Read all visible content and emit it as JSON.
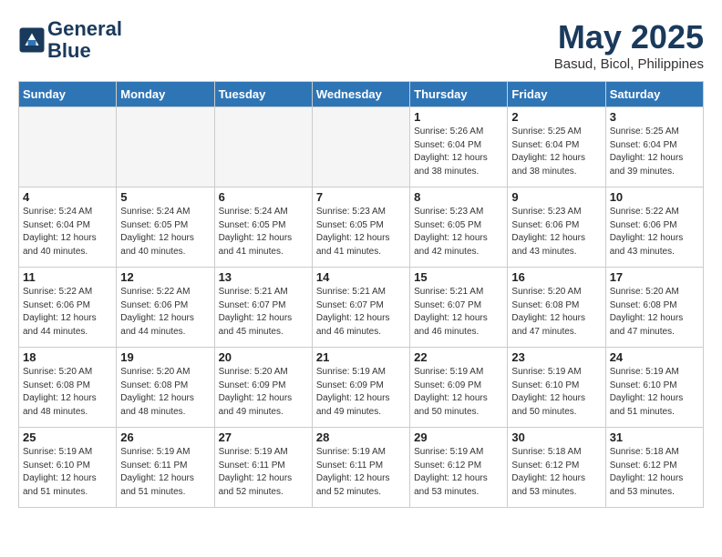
{
  "header": {
    "logo_line1": "General",
    "logo_line2": "Blue",
    "month": "May 2025",
    "location": "Basud, Bicol, Philippines"
  },
  "weekdays": [
    "Sunday",
    "Monday",
    "Tuesday",
    "Wednesday",
    "Thursday",
    "Friday",
    "Saturday"
  ],
  "weeks": [
    [
      {
        "day": "",
        "detail": ""
      },
      {
        "day": "",
        "detail": ""
      },
      {
        "day": "",
        "detail": ""
      },
      {
        "day": "",
        "detail": ""
      },
      {
        "day": "1",
        "detail": "Sunrise: 5:26 AM\nSunset: 6:04 PM\nDaylight: 12 hours\nand 38 minutes."
      },
      {
        "day": "2",
        "detail": "Sunrise: 5:25 AM\nSunset: 6:04 PM\nDaylight: 12 hours\nand 38 minutes."
      },
      {
        "day": "3",
        "detail": "Sunrise: 5:25 AM\nSunset: 6:04 PM\nDaylight: 12 hours\nand 39 minutes."
      }
    ],
    [
      {
        "day": "4",
        "detail": "Sunrise: 5:24 AM\nSunset: 6:04 PM\nDaylight: 12 hours\nand 40 minutes."
      },
      {
        "day": "5",
        "detail": "Sunrise: 5:24 AM\nSunset: 6:05 PM\nDaylight: 12 hours\nand 40 minutes."
      },
      {
        "day": "6",
        "detail": "Sunrise: 5:24 AM\nSunset: 6:05 PM\nDaylight: 12 hours\nand 41 minutes."
      },
      {
        "day": "7",
        "detail": "Sunrise: 5:23 AM\nSunset: 6:05 PM\nDaylight: 12 hours\nand 41 minutes."
      },
      {
        "day": "8",
        "detail": "Sunrise: 5:23 AM\nSunset: 6:05 PM\nDaylight: 12 hours\nand 42 minutes."
      },
      {
        "day": "9",
        "detail": "Sunrise: 5:23 AM\nSunset: 6:06 PM\nDaylight: 12 hours\nand 43 minutes."
      },
      {
        "day": "10",
        "detail": "Sunrise: 5:22 AM\nSunset: 6:06 PM\nDaylight: 12 hours\nand 43 minutes."
      }
    ],
    [
      {
        "day": "11",
        "detail": "Sunrise: 5:22 AM\nSunset: 6:06 PM\nDaylight: 12 hours\nand 44 minutes."
      },
      {
        "day": "12",
        "detail": "Sunrise: 5:22 AM\nSunset: 6:06 PM\nDaylight: 12 hours\nand 44 minutes."
      },
      {
        "day": "13",
        "detail": "Sunrise: 5:21 AM\nSunset: 6:07 PM\nDaylight: 12 hours\nand 45 minutes."
      },
      {
        "day": "14",
        "detail": "Sunrise: 5:21 AM\nSunset: 6:07 PM\nDaylight: 12 hours\nand 46 minutes."
      },
      {
        "day": "15",
        "detail": "Sunrise: 5:21 AM\nSunset: 6:07 PM\nDaylight: 12 hours\nand 46 minutes."
      },
      {
        "day": "16",
        "detail": "Sunrise: 5:20 AM\nSunset: 6:08 PM\nDaylight: 12 hours\nand 47 minutes."
      },
      {
        "day": "17",
        "detail": "Sunrise: 5:20 AM\nSunset: 6:08 PM\nDaylight: 12 hours\nand 47 minutes."
      }
    ],
    [
      {
        "day": "18",
        "detail": "Sunrise: 5:20 AM\nSunset: 6:08 PM\nDaylight: 12 hours\nand 48 minutes."
      },
      {
        "day": "19",
        "detail": "Sunrise: 5:20 AM\nSunset: 6:08 PM\nDaylight: 12 hours\nand 48 minutes."
      },
      {
        "day": "20",
        "detail": "Sunrise: 5:20 AM\nSunset: 6:09 PM\nDaylight: 12 hours\nand 49 minutes."
      },
      {
        "day": "21",
        "detail": "Sunrise: 5:19 AM\nSunset: 6:09 PM\nDaylight: 12 hours\nand 49 minutes."
      },
      {
        "day": "22",
        "detail": "Sunrise: 5:19 AM\nSunset: 6:09 PM\nDaylight: 12 hours\nand 50 minutes."
      },
      {
        "day": "23",
        "detail": "Sunrise: 5:19 AM\nSunset: 6:10 PM\nDaylight: 12 hours\nand 50 minutes."
      },
      {
        "day": "24",
        "detail": "Sunrise: 5:19 AM\nSunset: 6:10 PM\nDaylight: 12 hours\nand 51 minutes."
      }
    ],
    [
      {
        "day": "25",
        "detail": "Sunrise: 5:19 AM\nSunset: 6:10 PM\nDaylight: 12 hours\nand 51 minutes."
      },
      {
        "day": "26",
        "detail": "Sunrise: 5:19 AM\nSunset: 6:11 PM\nDaylight: 12 hours\nand 51 minutes."
      },
      {
        "day": "27",
        "detail": "Sunrise: 5:19 AM\nSunset: 6:11 PM\nDaylight: 12 hours\nand 52 minutes."
      },
      {
        "day": "28",
        "detail": "Sunrise: 5:19 AM\nSunset: 6:11 PM\nDaylight: 12 hours\nand 52 minutes."
      },
      {
        "day": "29",
        "detail": "Sunrise: 5:19 AM\nSunset: 6:12 PM\nDaylight: 12 hours\nand 53 minutes."
      },
      {
        "day": "30",
        "detail": "Sunrise: 5:18 AM\nSunset: 6:12 PM\nDaylight: 12 hours\nand 53 minutes."
      },
      {
        "day": "31",
        "detail": "Sunrise: 5:18 AM\nSunset: 6:12 PM\nDaylight: 12 hours\nand 53 minutes."
      }
    ]
  ]
}
